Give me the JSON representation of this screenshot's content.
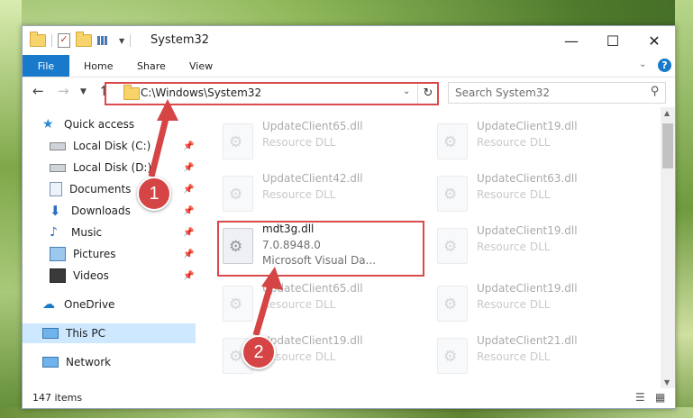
{
  "window": {
    "title": "System32"
  },
  "ribbon": {
    "file": "File",
    "tabs": [
      "Home",
      "Share",
      "View"
    ],
    "help": "?"
  },
  "nav": {
    "address": "C:\\Windows\\System32",
    "search_placeholder": "Search System32"
  },
  "sidebar": {
    "quick_access": "Quick access",
    "items": [
      {
        "label": "Local Disk (C:)",
        "icon": "drive-icon"
      },
      {
        "label": "Local Disk (D:)",
        "icon": "drive-icon"
      },
      {
        "label": "Documents",
        "icon": "documents-icon"
      },
      {
        "label": "Downloads",
        "icon": "downloads-icon"
      },
      {
        "label": "Music",
        "icon": "music-icon"
      },
      {
        "label": "Pictures",
        "icon": "pictures-icon"
      },
      {
        "label": "Videos",
        "icon": "videos-icon"
      }
    ],
    "onedrive": "OneDrive",
    "this_pc": "This PC",
    "network": "Network"
  },
  "files": [
    {
      "name": "UpdateClient65.dll",
      "sub": "Resource DLL"
    },
    {
      "name": "UpdateClient19.dll",
      "sub": "Resource DLL"
    },
    {
      "name": "UpdateClient42.dll",
      "sub": "Resource DLL"
    },
    {
      "name": "UpdateClient63.dll",
      "sub": "Resource DLL"
    },
    {
      "name": "mdt3g.dll",
      "sub": "7.0.8948.0",
      "sub2": "Microsoft Visual Da..."
    },
    {
      "name": "UpdateClient19.dll",
      "sub": "Resource DLL"
    },
    {
      "name": "UpdateClient65.dll",
      "sub": "Resource DLL"
    },
    {
      "name": "UpdateClient19.dll",
      "sub": "Resource DLL"
    },
    {
      "name": "UpdateClient19.dll",
      "sub": "Resource DLL"
    },
    {
      "name": "UpdateClient21.dll",
      "sub": "Resource DLL"
    }
  ],
  "status": {
    "count": "147 items"
  },
  "callouts": [
    "1",
    "2"
  ],
  "colors": {
    "accent": "#1979ca",
    "highlight": "#d94a4a",
    "selected": "#cde8ff"
  }
}
